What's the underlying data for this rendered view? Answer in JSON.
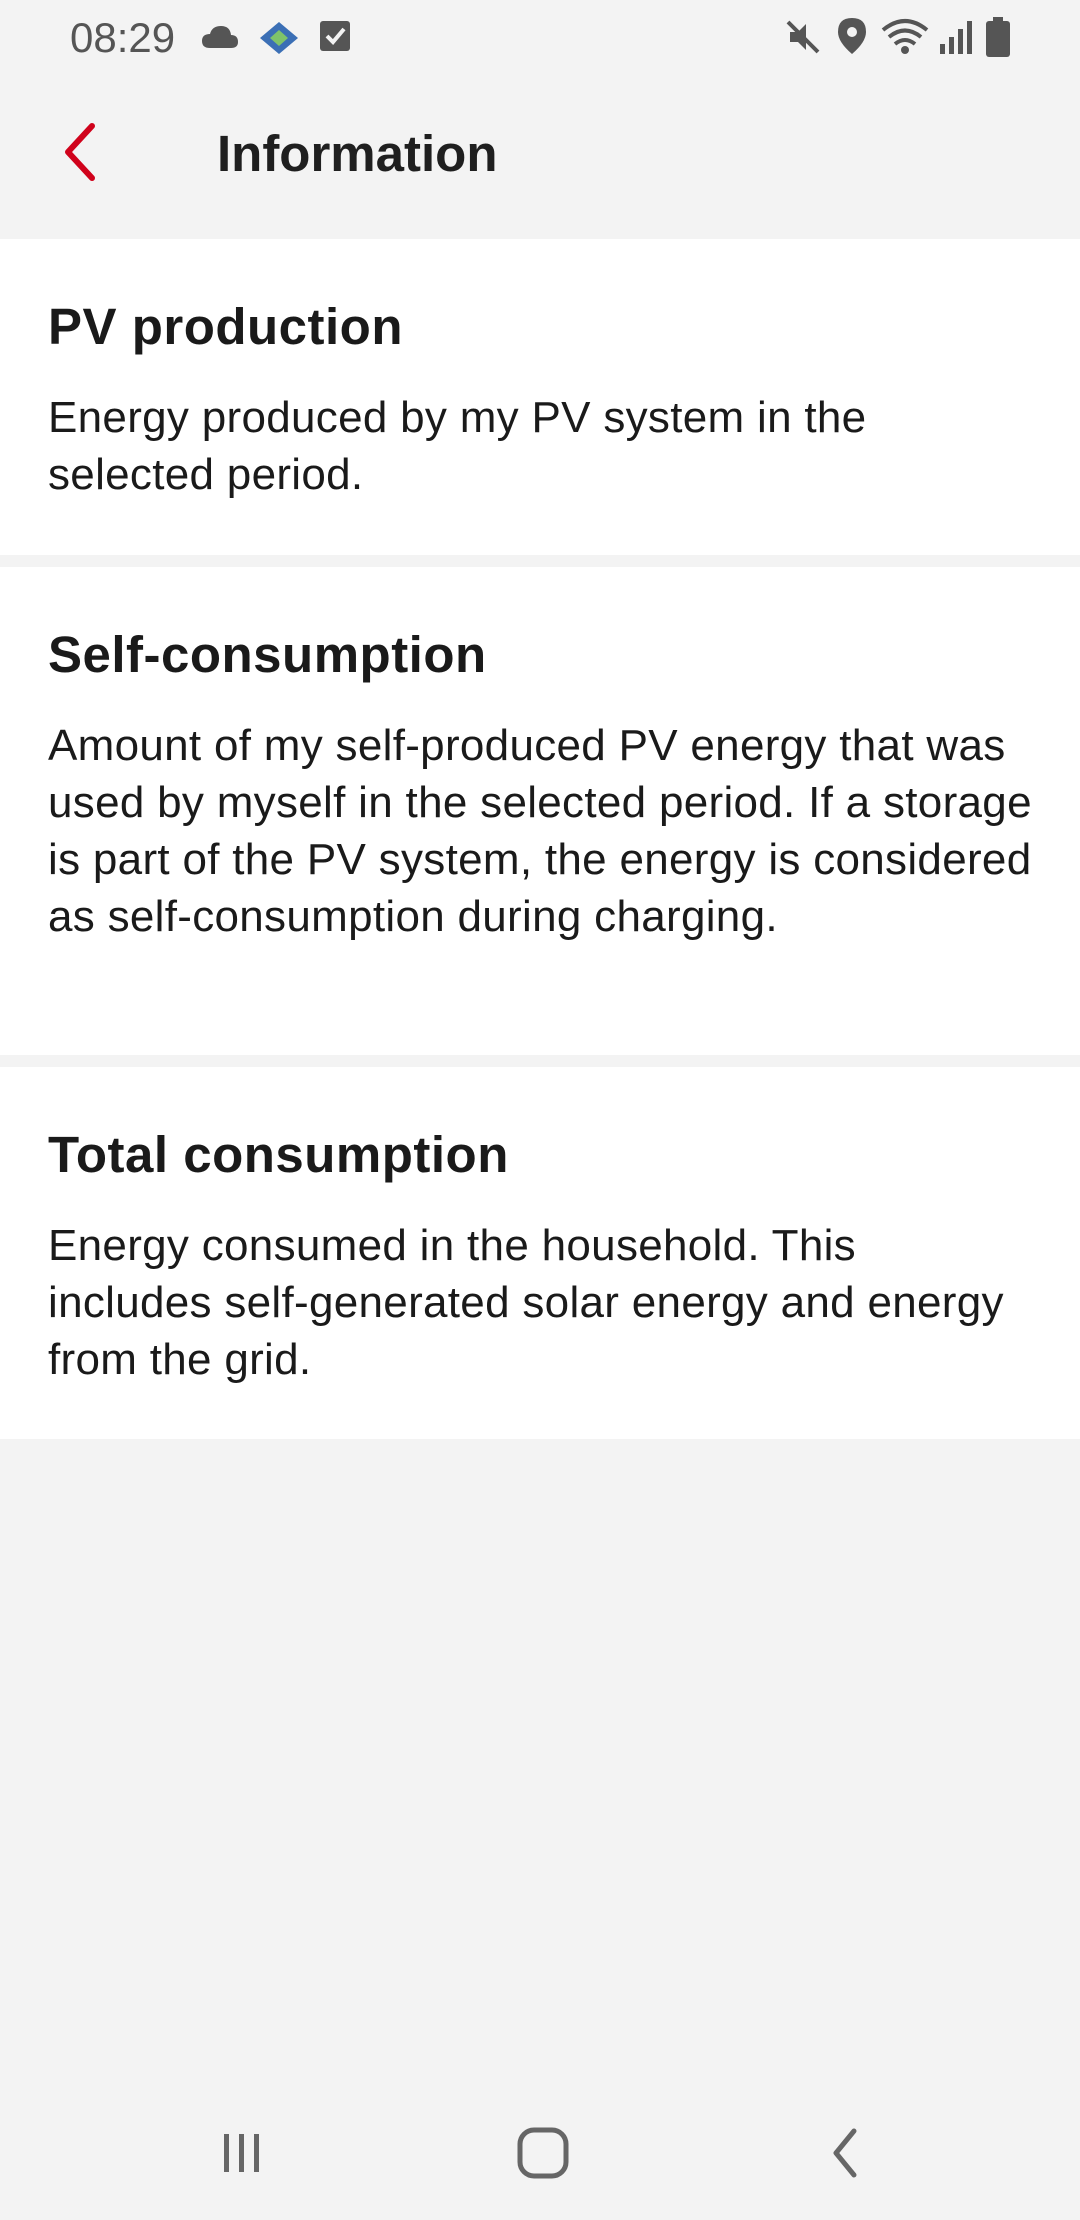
{
  "status_bar": {
    "time": "08:29",
    "icons": [
      "cloud-icon",
      "app-notification-icon",
      "checkbox-icon",
      "mute-icon",
      "location-icon",
      "wifi-icon",
      "signal-icon",
      "battery-icon"
    ]
  },
  "header": {
    "title": "Information",
    "back_icon": "chevron-left-icon",
    "accent_color": "#d0021b"
  },
  "sections": [
    {
      "title": "PV production",
      "text": "Energy produced by my PV system in the selected period."
    },
    {
      "title": "Self-consumption",
      "text": "Amount of my self-produced PV energy that was used by myself in the selected period. If a storage is part of the PV system, the energy is considered as self-consumption during charging."
    },
    {
      "title": "Total consumption",
      "text": "Energy consumed in the household. This includes self-generated solar energy and energy from the grid."
    }
  ],
  "nav_bar": {
    "icons": [
      "recent-apps-icon",
      "home-icon",
      "back-icon"
    ]
  }
}
